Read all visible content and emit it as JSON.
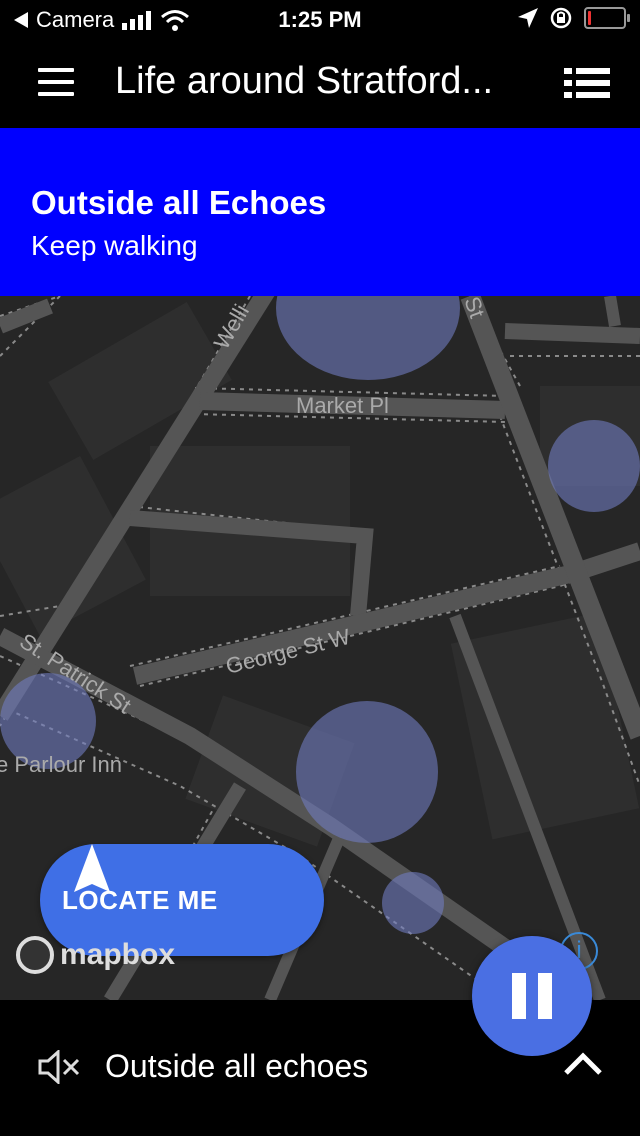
{
  "status_bar": {
    "back_app": "Camera",
    "time": "1:25 PM"
  },
  "nav": {
    "title": "Life around Stratford..."
  },
  "banner": {
    "title": "Outside all Echoes",
    "subtitle": "Keep walking",
    "background_color": "#0000ff"
  },
  "map": {
    "street_labels": [
      "Welli",
      "Market Pl",
      "George St W",
      "St. Patrick St",
      "e Parlour Inn",
      "St"
    ],
    "attribution": "mapbox",
    "zone_color": "#6f7bc0"
  },
  "locate_button": {
    "label": "LOCATE ME",
    "color": "#3f6fe6"
  },
  "footer": {
    "label": "Outside all echoes"
  },
  "pause_button": {
    "color": "#4a6fe3"
  }
}
